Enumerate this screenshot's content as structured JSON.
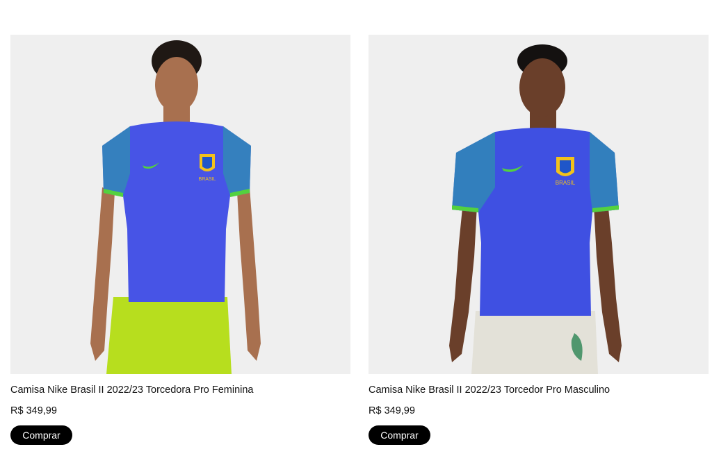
{
  "products": [
    {
      "title": "Camisa Nike Brasil II 2022/23 Torcedora Pro Feminina",
      "price": "R$ 349,99",
      "buy_label": "Comprar",
      "colors": {
        "shirt": "#4754e6",
        "sleeve_trim": "#53d13f",
        "shorts": "#b7de1e",
        "skin": "#a8704f",
        "hair": "#1f1814"
      }
    },
    {
      "title": "Camisa Nike Brasil II 2022/23 Torcedor Pro Masculino",
      "price": "R$ 349,99",
      "buy_label": "Comprar",
      "colors": {
        "shirt": "#3f50e2",
        "sleeve_trim": "#53d13f",
        "shorts": "#e3e1d8",
        "skin": "#6a3f2a",
        "hair": "#141110"
      }
    }
  ],
  "crest_text": "BRASIL"
}
